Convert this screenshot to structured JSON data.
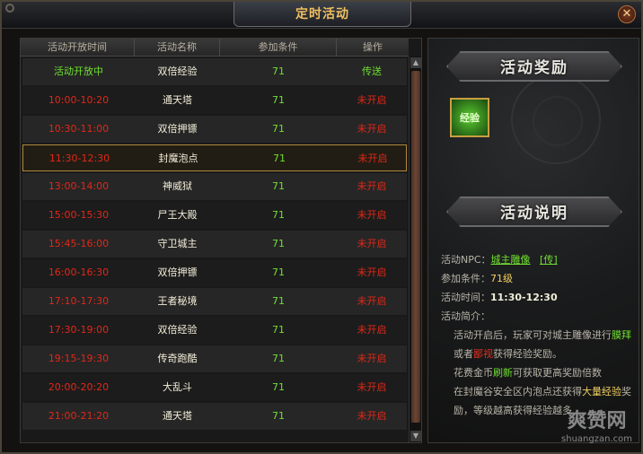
{
  "window": {
    "title": "定时活动",
    "close_label": "✕"
  },
  "table": {
    "headers": [
      "活动开放时间",
      "活动名称",
      "参加条件",
      "操作"
    ],
    "rows": [
      {
        "time": "活动开放中",
        "name": "双倍经验",
        "cond": "71",
        "op": "传送",
        "status": "open"
      },
      {
        "time": "10:00-10:20",
        "name": "通天塔",
        "cond": "71",
        "op": "未开启",
        "status": "closed"
      },
      {
        "time": "10:30-11:00",
        "name": "双倍押镖",
        "cond": "71",
        "op": "未开启",
        "status": "closed"
      },
      {
        "time": "11:30-12:30",
        "name": "封魔泡点",
        "cond": "71",
        "op": "未开启",
        "status": "closed",
        "selected": true
      },
      {
        "time": "13:00-14:00",
        "name": "神威狱",
        "cond": "71",
        "op": "未开启",
        "status": "closed"
      },
      {
        "time": "15:00-15:30",
        "name": "尸王大殿",
        "cond": "71",
        "op": "未开启",
        "status": "closed"
      },
      {
        "time": "15:45-16:00",
        "name": "守卫城主",
        "cond": "71",
        "op": "未开启",
        "status": "closed"
      },
      {
        "time": "16:00-16:30",
        "name": "双倍押镖",
        "cond": "71",
        "op": "未开启",
        "status": "closed"
      },
      {
        "time": "17:10-17:30",
        "name": "王者秘境",
        "cond": "71",
        "op": "未开启",
        "status": "closed"
      },
      {
        "time": "17:30-19:00",
        "name": "双倍经验",
        "cond": "71",
        "op": "未开启",
        "status": "closed"
      },
      {
        "time": "19:15-19:30",
        "name": "传奇跑酷",
        "cond": "71",
        "op": "未开启",
        "status": "closed"
      },
      {
        "time": "20:00-20:20",
        "name": "大乱斗",
        "cond": "71",
        "op": "未开启",
        "status": "closed"
      },
      {
        "time": "21:00-21:20",
        "name": "通天塔",
        "cond": "71",
        "op": "未开启",
        "status": "closed"
      }
    ]
  },
  "colors": {
    "open": "#70e030",
    "closed": "#e02818",
    "accent": "#f2d060",
    "frame": "#b08a3a"
  },
  "rewards": {
    "title": "活动奖励",
    "item_label": "经验",
    "item_icon": "exp-orb-icon"
  },
  "description": {
    "title": "活动说明",
    "npc_label": "活动NPC：",
    "npc_value": "城主雕像",
    "npc_teleport": "[传]",
    "cond_label": "参加条件：",
    "cond_value": "71级",
    "time_label": "活动时间：",
    "time_value": "11:30-12:30",
    "intro_label": "活动简介：",
    "p1_a": "活动开启后，玩家可对城主雕像进行",
    "p1_b": "膜拜",
    "p1_c": "或者",
    "p1_d": "鄙视",
    "p1_e": "获得经验奖励。",
    "p2_a": "花费金币",
    "p2_b": "刷新",
    "p2_c": "可获取更高奖励倍数",
    "p3_a": "在封魔谷安全区内泡点还获得",
    "p3_b": "大量经验",
    "p3_c": "奖励，等级越高获得经验越多"
  },
  "watermark": {
    "main": "爽赞网",
    "sub": "shuangzan.com"
  }
}
